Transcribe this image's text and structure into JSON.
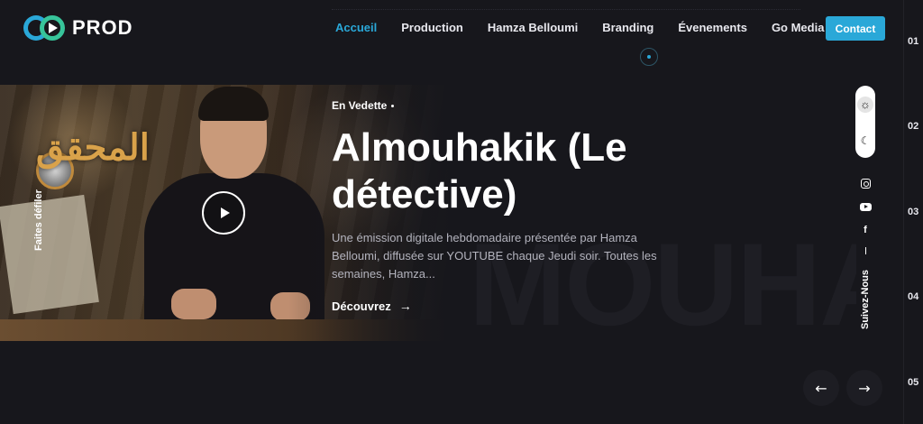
{
  "brand": {
    "logo_text": "PROD",
    "accent": "#2aa8d8",
    "accent2": "#37c49a"
  },
  "nav": {
    "items": [
      {
        "label": "Accueil",
        "active": true
      },
      {
        "label": "Production"
      },
      {
        "label": "Hamza Belloumi"
      },
      {
        "label": "Branding"
      },
      {
        "label": "Évenements"
      },
      {
        "label": "Go Media"
      }
    ],
    "contact_label": "Contact"
  },
  "slide_numbers": [
    "01",
    "02",
    "03",
    "04",
    "05"
  ],
  "hero": {
    "kicker": "En Vedette",
    "title": "Almouhakik (Le détective)",
    "description": "Une émission digitale hebdomadaire présentée par Hamza Belloumi, diffusée sur YOUTUBE chaque Jeudi soir. Toutes les semaines, Hamza...",
    "cta_label": "Découvrez",
    "scroll_hint": "Faites défiler",
    "image_arabic_title": "المحقق",
    "background_word": "MOUHAKIK"
  },
  "side": {
    "follow_label": "Suivez-Nous",
    "social_icons": [
      "instagram-icon",
      "youtube-icon",
      "facebook-icon"
    ]
  },
  "icons": {
    "sun": "☼",
    "moon": "☾",
    "prev": "←",
    "next": "→",
    "cta_arrow": "→",
    "facebook": "f"
  }
}
